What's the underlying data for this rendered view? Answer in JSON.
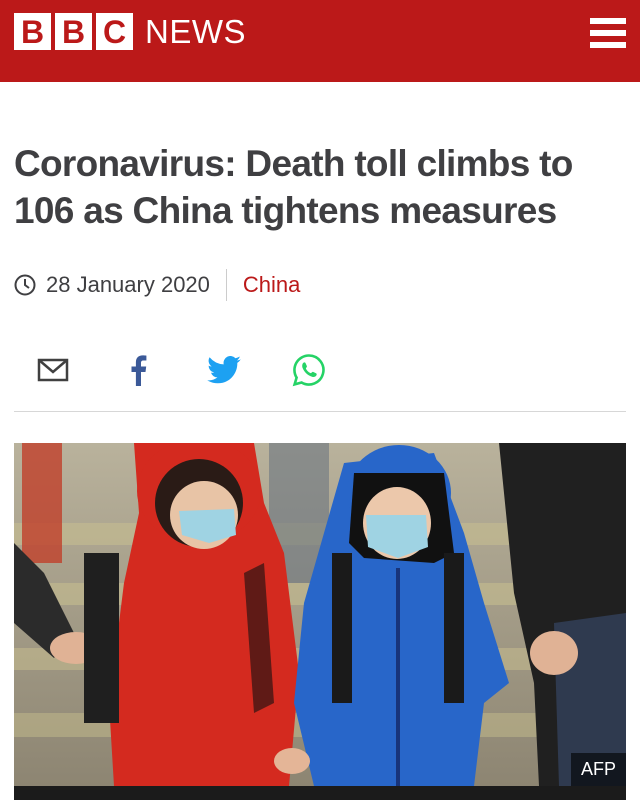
{
  "header": {
    "logo_letters": [
      "B",
      "B",
      "C"
    ],
    "logo_word": "NEWS",
    "brand_color": "#bb1919",
    "menu_icon": "hamburger-menu-icon"
  },
  "article": {
    "headline": "Coronavirus: Death toll climbs to 106 as China tightens measures",
    "date": "28 January 2020",
    "topic": "China"
  },
  "share": {
    "icons": [
      "email-icon",
      "facebook-icon",
      "twitter-icon",
      "whatsapp-icon"
    ],
    "colors": {
      "facebook": "#3b5998",
      "twitter": "#1da1f2",
      "whatsapp": "#25d366",
      "email": "#404040"
    }
  },
  "image": {
    "credit": "AFP"
  }
}
